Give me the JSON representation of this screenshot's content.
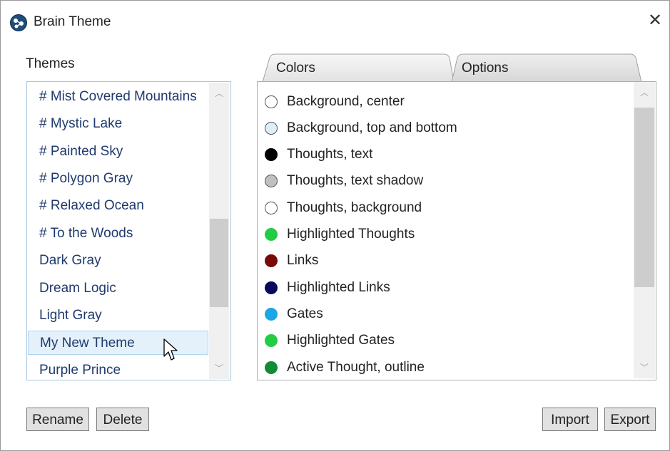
{
  "window": {
    "title": "Brain Theme",
    "close_glyph": "✕"
  },
  "themes": {
    "label": "Themes",
    "items": [
      {
        "label": "# Mist Covered Mountains"
      },
      {
        "label": "# Mystic Lake"
      },
      {
        "label": "# Painted Sky"
      },
      {
        "label": "# Polygon Gray"
      },
      {
        "label": "# Relaxed Ocean"
      },
      {
        "label": "# To the Woods"
      },
      {
        "label": "Dark Gray"
      },
      {
        "label": "Dream Logic"
      },
      {
        "label": "Light Gray"
      },
      {
        "label": "My New Theme",
        "selected": true
      },
      {
        "label": "Purple Prince"
      }
    ]
  },
  "tabs": [
    {
      "label": "Colors",
      "active": true
    },
    {
      "label": "Options",
      "active": false
    }
  ],
  "colors": [
    {
      "label": "Background, center",
      "color": "#ffffff"
    },
    {
      "label": "Background, top and bottom",
      "color": "#dceefa"
    },
    {
      "label": "Thoughts, text",
      "color": "#000000"
    },
    {
      "label": "Thoughts, text shadow",
      "color": "#c0c0c0"
    },
    {
      "label": "Thoughts, background",
      "color": "#ffffff"
    },
    {
      "label": "Highlighted Thoughts",
      "color": "#22cc44"
    },
    {
      "label": "Links",
      "color": "#7a0a0a"
    },
    {
      "label": "Highlighted Links",
      "color": "#0a0a5c"
    },
    {
      "label": "Gates",
      "color": "#1ba6e6"
    },
    {
      "label": "Highlighted Gates",
      "color": "#22cc44"
    },
    {
      "label": "Active Thought, outline",
      "color": "#138a3a"
    }
  ],
  "buttons": {
    "rename": "Rename",
    "delete": "Delete",
    "import": "Import",
    "export": "Export"
  },
  "scroll_glyphs": {
    "up": "︿",
    "down": "﹀"
  }
}
